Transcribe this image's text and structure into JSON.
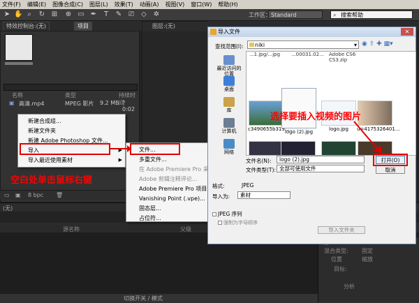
{
  "menubar": [
    "文件(F)",
    "编辑(E)",
    "图像合成(C)",
    "图层(L)",
    "效果(T)",
    "动画(A)",
    "视图(V)",
    "窗口(W)",
    "帮助(H)"
  ],
  "toolbar": {
    "workspace_label": "工作区：",
    "workspace_value": "Standard",
    "search_placeholder": "搜索帮助"
  },
  "panels": {
    "effects_tab": "特效控制台:(无)",
    "project_tab": "项目",
    "comp_tab": "图层:(无)"
  },
  "project": {
    "columns": {
      "name": "名称",
      "type": "类型",
      "duration": "持续时间"
    },
    "file": {
      "name": "高清.mp4",
      "type": "MPEG 影片",
      "size": "9.2 MB",
      "duration": "? 0:02"
    },
    "bpc": "8 bpc"
  },
  "timeline": {
    "tab": "(无)",
    "col_source": "源名称",
    "col_parent": "父级",
    "switch_mode": "切换开关 / 模式"
  },
  "right_panel": {
    "row1": "源",
    "row2": "混合类型:",
    "row2_value": "固定",
    "row3": "位置",
    "row4": "缩放",
    "row5": "目标:",
    "row6": "分析"
  },
  "context_menu": {
    "items": [
      "新建合成组...",
      "新建文件夹",
      "新建 Adobe Photoshop 文件...",
      "导入",
      "导入最近使用素材"
    ]
  },
  "submenu": {
    "items": [
      "文件...",
      "多重文件...",
      "在 Adobe Premiere Pro 采集",
      "Adobe 剪辑注释评论...",
      "Adobe Premiere Pro 项目...",
      "Vanishing Point (.vpe)...",
      "固态层...",
      "占位符..."
    ]
  },
  "annotations": {
    "right_click": "空白处单击鼠标右键",
    "choose_image": "选择要插入视频的图片"
  },
  "dialog": {
    "title": "导入文件",
    "close": "✕",
    "lookin_label": "查找范围(I):",
    "lookin_value": "niki",
    "places": [
      "最近访问的位置",
      "桌面",
      "库",
      "计算机",
      "网络"
    ],
    "top_names": [
      "...1.jpg/...jpg",
      "...00031.02...",
      "Adobe CS6",
      "CS3.zip"
    ],
    "files": [
      {
        "name": "",
        "caption": ""
      },
      {
        "name": "logo (2).jpg"
      },
      {
        "name": "logo.jpg"
      },
      {
        "name": "c3490655b319..."
      },
      {
        "name": "u=4175326401..."
      }
    ],
    "filename_label": "文件名(N):",
    "filename_value": "logo (2).jpg",
    "filetype_label": "文件类型(T):",
    "filetype_value": "全部可使用文件",
    "open": "打开(O)",
    "cancel": "取消",
    "format_label": "格式:",
    "format_value": "JPEG",
    "importas_label": "导入为:",
    "importas_value": "素材",
    "sequence_label": "JPEG 序列",
    "force_label": "强制为字母顺序",
    "import_folder": "导入文件夹"
  },
  "colors": {
    "accent": "#e00000",
    "dialog_border": "#6b8bb4"
  }
}
